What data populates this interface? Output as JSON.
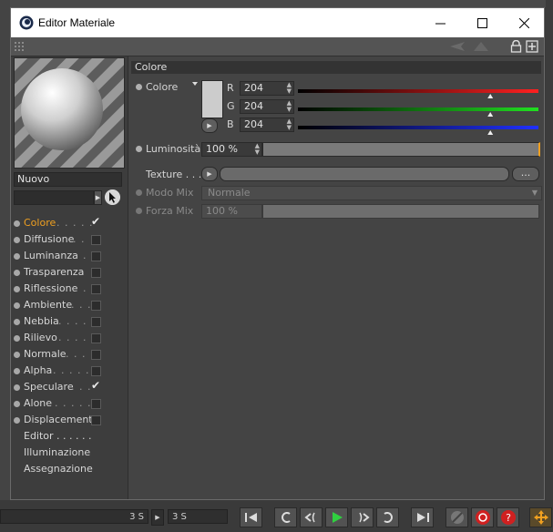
{
  "window": {
    "title": "Editor Materiale"
  },
  "sidebar": {
    "material_name": "Nuovo",
    "channels": [
      {
        "label": "Colore",
        "dots": ". . . . .",
        "checked": true,
        "active": true
      },
      {
        "label": "Diffusione",
        "dots": ". .",
        "checked": false,
        "active": false
      },
      {
        "label": "Luminanza",
        "dots": ". .",
        "checked": false,
        "active": false
      },
      {
        "label": "Trasparenza",
        "dots": "",
        "checked": false,
        "active": false
      },
      {
        "label": "Riflessione",
        "dots": ". .",
        "checked": false,
        "active": false
      },
      {
        "label": "Ambiente",
        "dots": ". . .",
        "checked": false,
        "active": false
      },
      {
        "label": "Nebbia",
        "dots": ". . . . .",
        "checked": false,
        "active": false
      },
      {
        "label": "Rilievo",
        "dots": ". . . . .",
        "checked": false,
        "active": false
      },
      {
        "label": "Normale",
        "dots": ". . . .",
        "checked": false,
        "active": false
      },
      {
        "label": "Alpha",
        "dots": ". . . . . .",
        "checked": false,
        "active": false
      },
      {
        "label": "Speculare",
        "dots": ". . .",
        "checked": true,
        "active": false
      },
      {
        "label": "Alone",
        "dots": ". . . . .",
        "checked": false,
        "active": false
      },
      {
        "label": "Displacement",
        "dots": "",
        "checked": false,
        "active": false
      }
    ],
    "extras": [
      {
        "label": "Editor . . . . . ."
      },
      {
        "label": "Illuminazione"
      },
      {
        "label": "Assegnazione"
      }
    ]
  },
  "panel": {
    "section_title": "Colore",
    "color_label": "Colore",
    "r_label": "R",
    "r_value": "204",
    "g_label": "G",
    "g_value": "204",
    "b_label": "B",
    "b_value": "204",
    "channel_value": 0.8,
    "luminosity_label": "Luminosità",
    "luminosity_value": "100 %",
    "texture_label": "Texture . . .",
    "texture_button": "...",
    "mix_mode_label": "Modo Mix",
    "mix_mode_value": "Normale",
    "mix_strength_label": "Forza Mix",
    "mix_strength_value": "100 %"
  },
  "timeline": {
    "left_value": "3 S",
    "frame_value": "3 S"
  },
  "colors": {
    "accent": "#f0a020",
    "red": "#d02020",
    "green": "#20c020",
    "blue": "#2030d0"
  }
}
